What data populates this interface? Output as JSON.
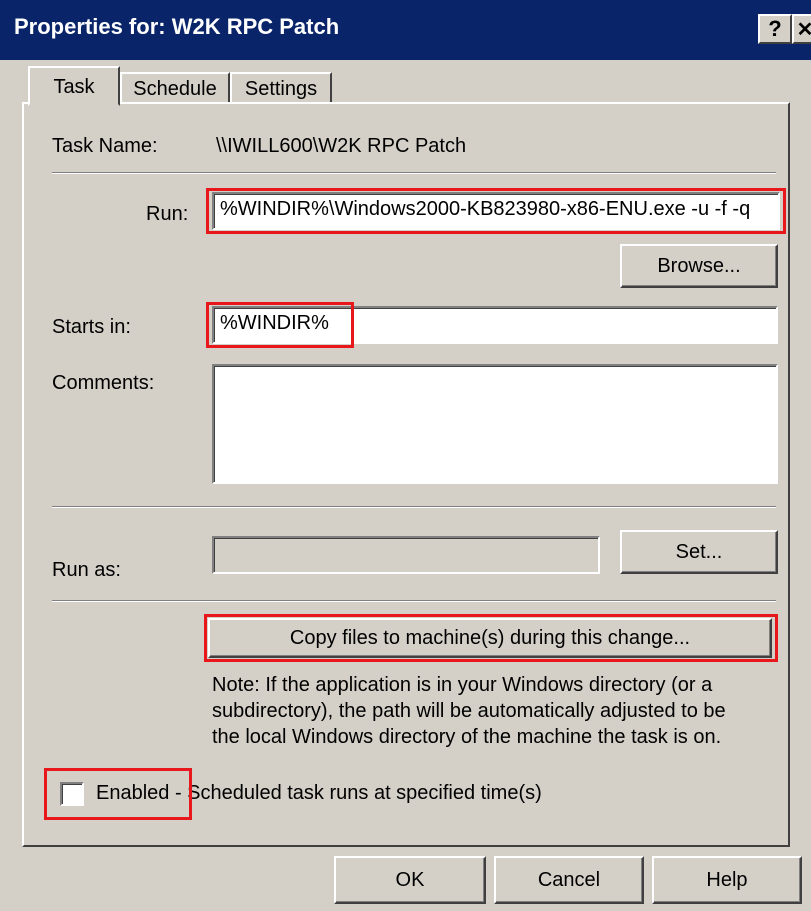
{
  "window": {
    "title": "Properties for: W2K RPC Patch",
    "help_glyph": "?",
    "close_glyph": "✕"
  },
  "tabs": [
    {
      "label": "Task",
      "active": true
    },
    {
      "label": "Schedule",
      "active": false
    },
    {
      "label": "Settings",
      "active": false
    }
  ],
  "task": {
    "task_name_label": "Task Name:",
    "task_name_value": "\\\\IWILL600\\W2K RPC Patch",
    "run_label": "Run:",
    "run_value": "%WINDIR%\\Windows2000-KB823980-x86-ENU.exe -u -f -q",
    "browse_label": "Browse...",
    "starts_in_label": "Starts in:",
    "starts_in_value": "%WINDIR%",
    "comments_label": "Comments:",
    "comments_value": "",
    "run_as_label": "Run as:",
    "run_as_value": "",
    "set_label": "Set...",
    "copy_files_label": "Copy files to machine(s) during this change...",
    "note_lines": [
      "Note: If the application is in your Windows directory (or a",
      "subdirectory), the path will be automatically adjusted to be",
      "the local Windows directory of the machine the task is on."
    ],
    "enabled_label": "Enabled - Scheduled task runs at specified time(s)",
    "enabled_checked": false
  },
  "footer": {
    "ok_label": "OK",
    "cancel_label": "Cancel",
    "help_label": "Help"
  },
  "colors": {
    "titlebar": "#0a246a",
    "face": "#d4d0c8",
    "highlight_box": "#e8171c"
  }
}
